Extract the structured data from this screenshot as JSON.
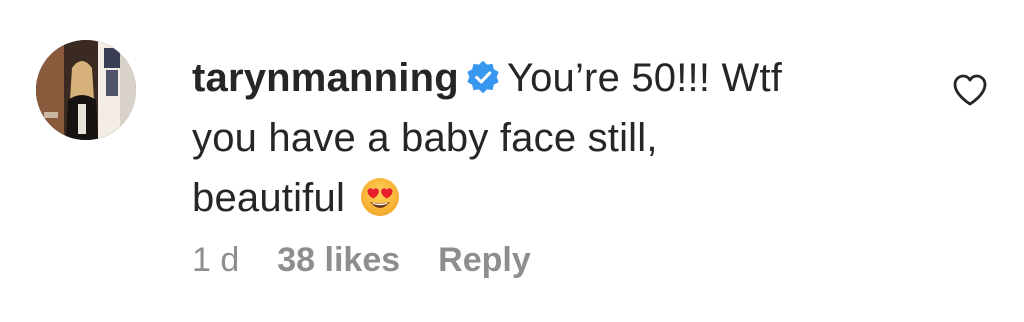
{
  "comment": {
    "username": "tarynmanning",
    "verified": true,
    "text_line1": "You’re 50!!! Wtf",
    "text_line2": "you have a baby face still,",
    "text_line3": "beautiful",
    "emoji": "heart-eyes-emoji",
    "time": "1 d",
    "likes": "38 likes",
    "reply_label": "Reply"
  },
  "icons": {
    "verified": "verified-badge-icon",
    "like": "heart-outline-icon"
  },
  "colors": {
    "text": "#262626",
    "muted": "#8e8e8e",
    "verified_blue": "#3897f0"
  }
}
